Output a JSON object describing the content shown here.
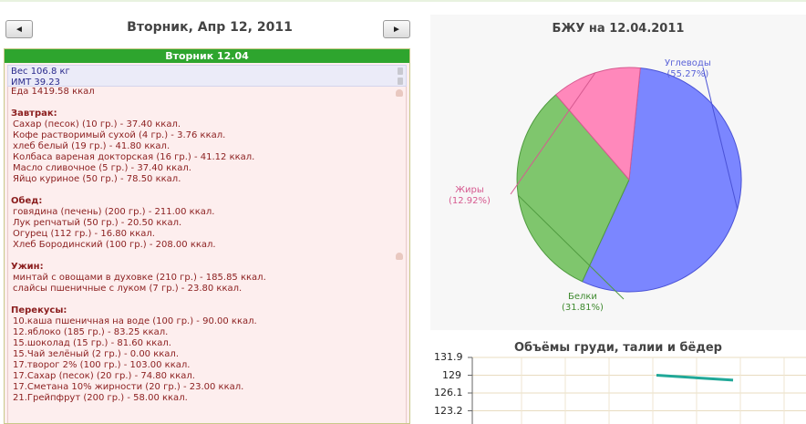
{
  "header": {
    "prev_label": "◄",
    "next_label": "►",
    "date_title": "Вторник, Апр 12, 2011"
  },
  "day": {
    "bar_label": "Вторник 12.04",
    "weight": "Вес 106.8 кг",
    "bmi": "ИМТ 39.23",
    "food_total": "Еда 1419.58 ккал",
    "meals": [
      {
        "title": "Завтрак:",
        "items": [
          "Сахар (песок) (10 гр.) - 37.40 ккал.",
          "Кофе растворимый сухой (4 гр.) - 3.76 ккал.",
          "хлеб белый (19 гр.) - 41.80 ккал.",
          "Колбаса вареная докторская (16 гр.) - 41.12 ккал.",
          "Масло сливочное (5 гр.) - 37.40 ккал.",
          "Яйцо куриное (50 гр.) - 78.50 ккал."
        ]
      },
      {
        "title": "Обед:",
        "items": [
          "говядина (печень) (200 гр.) - 211.00 ккал.",
          "Лук репчатый (50 гр.) - 20.50 ккал.",
          "Огурец (112 гр.) - 16.80 ккал.",
          "Хлеб Бородинский (100 гр.) - 208.00 ккал."
        ]
      },
      {
        "title": "Ужин:",
        "items": [
          "минтай с овощами в духовке (210 гр.) - 185.85 ккал.",
          "слайсы пшеничные с луком (7 гр.) - 23.80 ккал."
        ]
      },
      {
        "title": "Перекусы:",
        "items": [
          "10.каша пшеничная на воде (100 гр.) - 90.00 ккал.",
          "12.яблоко (185 гр.) - 83.25 ккал.",
          "15.шоколад (15 гр.) - 81.60 ккал.",
          "15.Чай зелёный (2 гр.) - 0.00 ккал.",
          "17.творог 2% (100 гр.) - 103.00 ккал.",
          "17.Сахар (песок) (20 гр.) - 74.80 ккал.",
          "17.Сметана 10% жирности (20 гр.) - 23.00 ккал.",
          "21.Грейпфрут (200 гр.) - 58.00 ккал."
        ]
      }
    ]
  },
  "pie_chart": {
    "title": "БЖУ на 12.04.2011",
    "slices": [
      {
        "name": "Углеводы",
        "percent_label": "(55.27%)",
        "value": 55.27,
        "color": "#7b86ff",
        "stroke": "#4a52d6",
        "text_color": "#5b63d8"
      },
      {
        "name": "Белки",
        "percent_label": "(31.81%)",
        "value": 31.81,
        "color": "#7fc66d",
        "stroke": "#4f9a3f",
        "text_color": "#3f8a2f"
      },
      {
        "name": "Жиры",
        "percent_label": "(12.92%)",
        "value": 12.92,
        "color": "#ff88bb",
        "stroke": "#d65a90",
        "text_color": "#d65a90"
      }
    ]
  },
  "line_chart": {
    "title": "Объёмы груди, талии и бёдер",
    "y_ticks": [
      "131.9",
      "129",
      "126.1",
      "123.2"
    ],
    "y_values": [
      131.9,
      129,
      126.1,
      123.2
    ],
    "series": [
      {
        "points": [
          129.0,
          128.2
        ],
        "color": "#20a898"
      }
    ]
  },
  "colors": {
    "day_bar": "#2ea52e",
    "food_text": "#8b1e1e",
    "metrics_text": "#2a2a8c"
  }
}
